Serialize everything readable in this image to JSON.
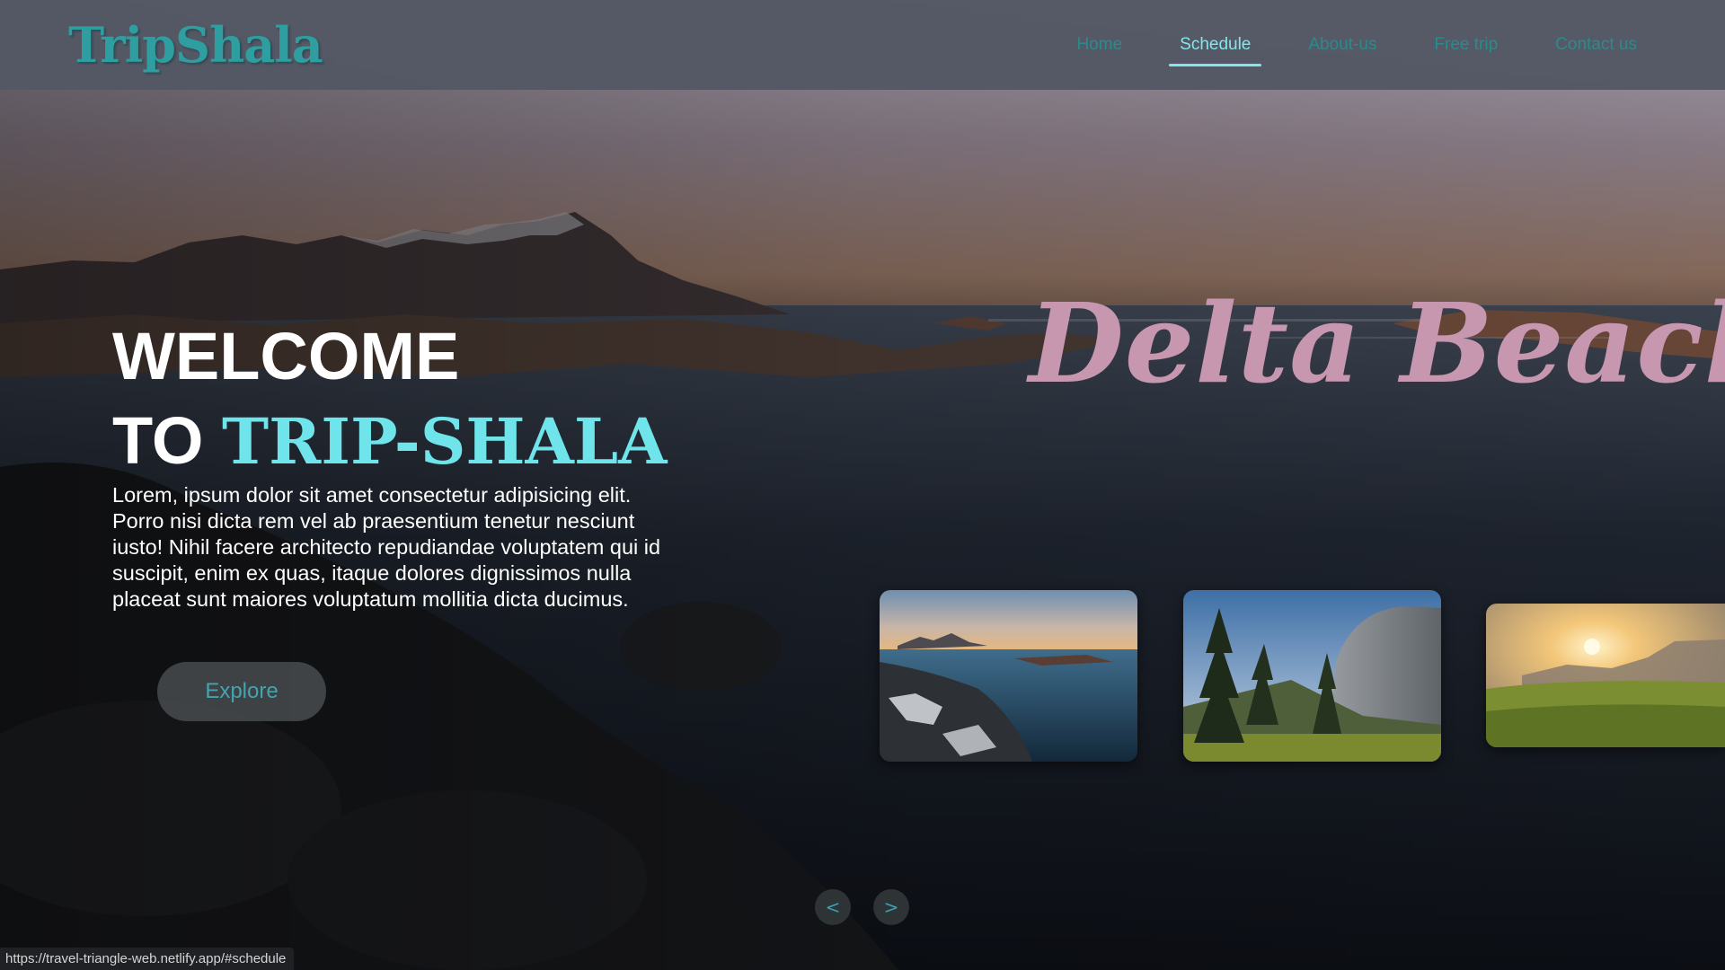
{
  "site": {
    "brand": "TripShala"
  },
  "nav": {
    "items": [
      {
        "label": "Home",
        "active": false
      },
      {
        "label": "Schedule",
        "active": true
      },
      {
        "label": "About-us",
        "active": false
      },
      {
        "label": "Free trip",
        "active": false
      },
      {
        "label": "Contact us",
        "active": false
      }
    ]
  },
  "hero": {
    "title_line1": "WELCOME",
    "title_line2_prefix": "TO ",
    "title_line2_accent": "TRIP-SHALA",
    "description": "Lorem, ipsum dolor sit amet consectetur adipisicing elit. Porro nisi dicta rem vel ab praesentium tenetur nesciunt iusto! Nihil facere architecto repudiandae voluptatem qui id suscipit, enim ex quas, itaque dolores dignissimos nulla placeat sunt maiores voluptatum mollitia dicta ducimus.",
    "explore_label": "Explore",
    "featured_destination": "Delta Beach"
  },
  "carousel": {
    "prev_label": "<",
    "next_label": ">",
    "thumbnails": [
      "coastal-rocks-sunset",
      "forest-cliff-valley",
      "meadow-sunrise"
    ]
  },
  "status_bar": {
    "url": "https://travel-triangle-web.netlify.app/#schedule"
  },
  "colors": {
    "accent": "#7fe8ec",
    "brand": "#2f9ea0",
    "feature_title": "#c797b0",
    "navbar_bg": "#545864"
  }
}
